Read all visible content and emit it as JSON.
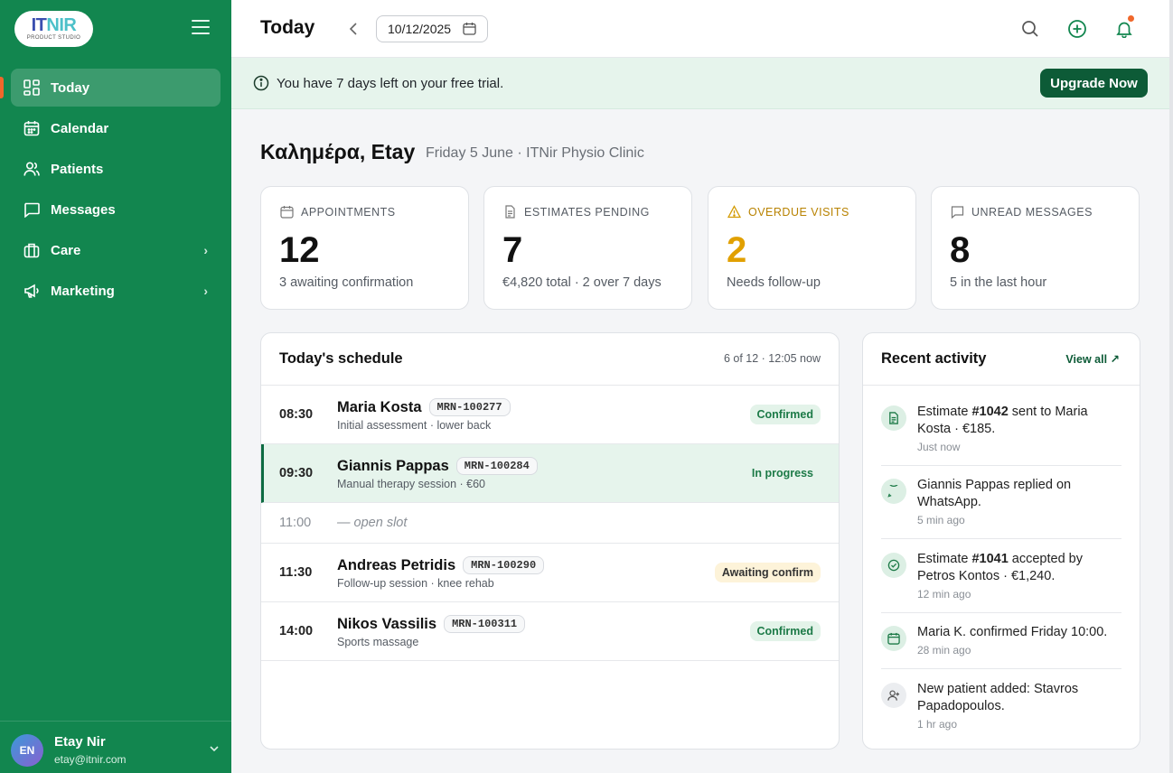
{
  "app": {
    "logo_text_a": "IT",
    "logo_text_b": "NIR",
    "logo_sub": "PRODUCT STUDIO",
    "accent": "#12864f",
    "dark_accent": "#0d5b37"
  },
  "sidebar": {
    "items": [
      {
        "label": "Today",
        "icon": "dashboard-icon",
        "active": true
      },
      {
        "label": "Calendar",
        "icon": "calendar-icon"
      },
      {
        "label": "Patients",
        "icon": "users-icon"
      },
      {
        "label": "Messages",
        "icon": "message-icon"
      },
      {
        "label": "Care",
        "icon": "briefcase-icon",
        "has_children": true
      },
      {
        "label": "Marketing",
        "icon": "megaphone-icon",
        "has_children": true
      }
    ],
    "user": {
      "initials": "EN",
      "name": "Etay Nir",
      "email": "etay@itnir.com"
    }
  },
  "header": {
    "title": "Today",
    "date": "10/12/2025"
  },
  "trial": {
    "message": "You have 7 days left on your free trial.",
    "upgrade_label": "Upgrade Now"
  },
  "greeting": {
    "title": "Καλημέρα, Etay",
    "subtitle": "Friday 5 June · ITNir Physio Clinic"
  },
  "stats": [
    {
      "label": "APPOINTMENTS",
      "value": "12",
      "sub": "3 awaiting confirmation",
      "icon": "calendar-icon"
    },
    {
      "label": "ESTIMATES PENDING",
      "value": "7",
      "sub": "€4,820 total · 2 over 7 days",
      "icon": "document-icon"
    },
    {
      "label": "OVERDUE VISITS",
      "value": "2",
      "sub": "Needs follow-up",
      "icon": "warning-icon",
      "warn_color": "#e1a000"
    },
    {
      "label": "UNREAD MESSAGES",
      "value": "8",
      "sub": "5 in the last hour",
      "icon": "message-icon"
    }
  ],
  "schedule": {
    "title": "Today's schedule",
    "meta": "6 of 12 · 12:05 now",
    "rows": [
      {
        "time": "08:30",
        "name": "Maria Kosta",
        "mrn": "MRN-100277",
        "desc": "Initial assessment · lower back",
        "status": "Confirmed"
      },
      {
        "time": "09:30",
        "name": "Giannis Pappas",
        "mrn": "MRN-100284",
        "desc": "Manual therapy session · €60",
        "status": "In progress"
      },
      {
        "time": "11:00",
        "open_slot": "— open slot"
      },
      {
        "time": "11:30",
        "name": "Andreas Petridis",
        "mrn": "MRN-100290",
        "desc": "Follow-up session · knee rehab",
        "status": "Awaiting confirm"
      },
      {
        "time": "14:00",
        "name": "Nikos Vassilis",
        "mrn": "MRN-100311",
        "desc": "Sports massage",
        "status": "Confirmed"
      }
    ]
  },
  "activity": {
    "title": "Recent activity",
    "view_all": "View all ↗",
    "items": [
      {
        "pre": "Estimate ",
        "bold": "#1042",
        "post": " sent to Maria Kosta · €185.",
        "time": "Just now",
        "icon": "document-icon"
      },
      {
        "pre": "Giannis Pappas replied on WhatsApp.",
        "bold": "",
        "post": "",
        "time": "5 min ago",
        "icon": "chat-icon"
      },
      {
        "pre": "Estimate ",
        "bold": "#1041",
        "post": " accepted by Petros Kontos · €1,240.",
        "time": "12 min ago",
        "icon": "check-circle-icon"
      },
      {
        "pre": "Maria K. confirmed Friday 10:00.",
        "bold": "",
        "post": "",
        "time": "28 min ago",
        "icon": "calendar-icon"
      },
      {
        "pre": "New patient added: Stavros Papadopoulos.",
        "bold": "",
        "post": "",
        "time": "1 hr ago",
        "icon": "user-plus-icon"
      }
    ]
  }
}
